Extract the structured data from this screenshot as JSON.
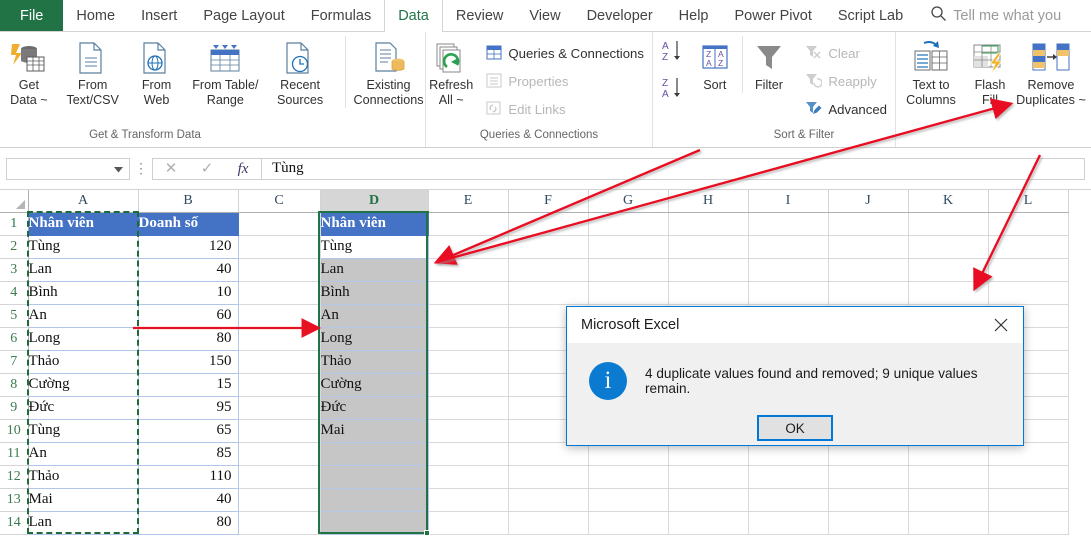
{
  "app": {
    "name": "Microsoft Excel"
  },
  "tabs": [
    {
      "label": "File",
      "active": false,
      "file": true
    },
    {
      "label": "Home",
      "active": false
    },
    {
      "label": "Insert",
      "active": false
    },
    {
      "label": "Page Layout",
      "active": false
    },
    {
      "label": "Formulas",
      "active": false
    },
    {
      "label": "Data",
      "active": true
    },
    {
      "label": "Review",
      "active": false
    },
    {
      "label": "View",
      "active": false
    },
    {
      "label": "Developer",
      "active": false
    },
    {
      "label": "Help",
      "active": false
    },
    {
      "label": "Power Pivot",
      "active": false
    },
    {
      "label": "Script Lab",
      "active": false
    }
  ],
  "tellme": {
    "placeholder": "Tell me what you",
    "icon": "search-icon"
  },
  "ribbon": {
    "groups": [
      {
        "label": "Get & Transform Data",
        "buttons": [
          {
            "label": "Get\nData ~",
            "icon": "get-data-icon"
          },
          {
            "label": "From\nText/CSV",
            "icon": "from-text-csv-icon"
          },
          {
            "label": "From\nWeb",
            "icon": "from-web-icon"
          },
          {
            "label": "From Table/\nRange",
            "icon": "from-table-range-icon"
          },
          {
            "label": "Recent\nSources",
            "icon": "recent-sources-icon"
          },
          {
            "label": "Existing\nConnections",
            "icon": "existing-connections-icon"
          }
        ]
      },
      {
        "label": "Queries & Connections",
        "big": {
          "label": "Refresh\nAll ~",
          "icon": "refresh-all-icon"
        },
        "items": [
          {
            "label": "Queries & Connections",
            "icon": "queries-connections-icon",
            "disabled": false
          },
          {
            "label": "Properties",
            "icon": "properties-icon",
            "disabled": true
          },
          {
            "label": "Edit Links",
            "icon": "edit-links-icon",
            "disabled": true
          }
        ]
      },
      {
        "label": "Sort & Filter",
        "sort": {
          "label": "Sort",
          "icon": "sort-az-icon"
        },
        "asc": "sort-ascending-icon",
        "desc": "sort-descending-icon",
        "filter": {
          "label": "Filter",
          "icon": "filter-funnel-icon"
        },
        "items": [
          {
            "label": "Clear",
            "icon": "clear-filter-icon",
            "disabled": true
          },
          {
            "label": "Reapply",
            "icon": "reapply-filter-icon",
            "disabled": true
          },
          {
            "label": "Advanced",
            "icon": "advanced-filter-icon",
            "disabled": false
          }
        ]
      },
      {
        "label": "",
        "buttons": [
          {
            "label": "Text to\nColumns",
            "icon": "text-to-columns-icon"
          },
          {
            "label": "Flash\nFill",
            "icon": "flash-fill-icon"
          },
          {
            "label": "Remove\nDuplicates ~",
            "icon": "remove-duplicates-icon"
          }
        ]
      }
    ]
  },
  "formula_bar": {
    "name_box_value": "",
    "cancel_icon": "cancel-icon",
    "enter_icon": "confirm-icon",
    "fx_icon": "insert-function-icon",
    "value": "Tùng"
  },
  "grid": {
    "columns": [
      "A",
      "B",
      "C",
      "D",
      "E",
      "F",
      "G",
      "H",
      "I",
      "J",
      "K",
      "L"
    ],
    "selected_column": "D",
    "rows": [
      1,
      2,
      3,
      4,
      5,
      6,
      7,
      8,
      9,
      10,
      11,
      12,
      13,
      14
    ],
    "headers": {
      "a1": "Nhân viên",
      "b1": "Doanh số",
      "d1": "Nhân viên"
    },
    "source": [
      {
        "name": "Tùng",
        "sales": "120"
      },
      {
        "name": "Lan",
        "sales": "40"
      },
      {
        "name": "Bình",
        "sales": "10"
      },
      {
        "name": "An",
        "sales": "60"
      },
      {
        "name": "Long",
        "sales": "80"
      },
      {
        "name": "Thảo",
        "sales": "150"
      },
      {
        "name": "Cường",
        "sales": "15"
      },
      {
        "name": "Đức",
        "sales": "95"
      },
      {
        "name": "Tùng",
        "sales": "65"
      },
      {
        "name": "An",
        "sales": "85"
      },
      {
        "name": "Thảo",
        "sales": "110"
      },
      {
        "name": "Mai",
        "sales": "40"
      },
      {
        "name": "Lan",
        "sales": "80"
      }
    ],
    "result": [
      "Tùng",
      "Lan",
      "Bình",
      "An",
      "Long",
      "Thảo",
      "Cường",
      "Đức",
      "Mai"
    ],
    "active_cell_value": "Tùng"
  },
  "dialog": {
    "title": "Microsoft Excel",
    "close_icon": "close-icon",
    "info_icon": "info-icon",
    "message": "4 duplicate values found and removed; 9 unique values remain.",
    "ok_label": "OK"
  },
  "annotations": [
    {
      "name": "arrow-to-result-column",
      "color": "#e81123"
    },
    {
      "name": "arrow-to-remove-duplicates",
      "color": "#e81123"
    },
    {
      "name": "arrow-source-to-result",
      "color": "#e81123"
    }
  ],
  "colors": {
    "excel_green": "#217346",
    "table_header_blue": "#4472c4",
    "selection_green": "#217346",
    "annotation_red": "#e81123",
    "dialog_accent": "#0078d7"
  }
}
